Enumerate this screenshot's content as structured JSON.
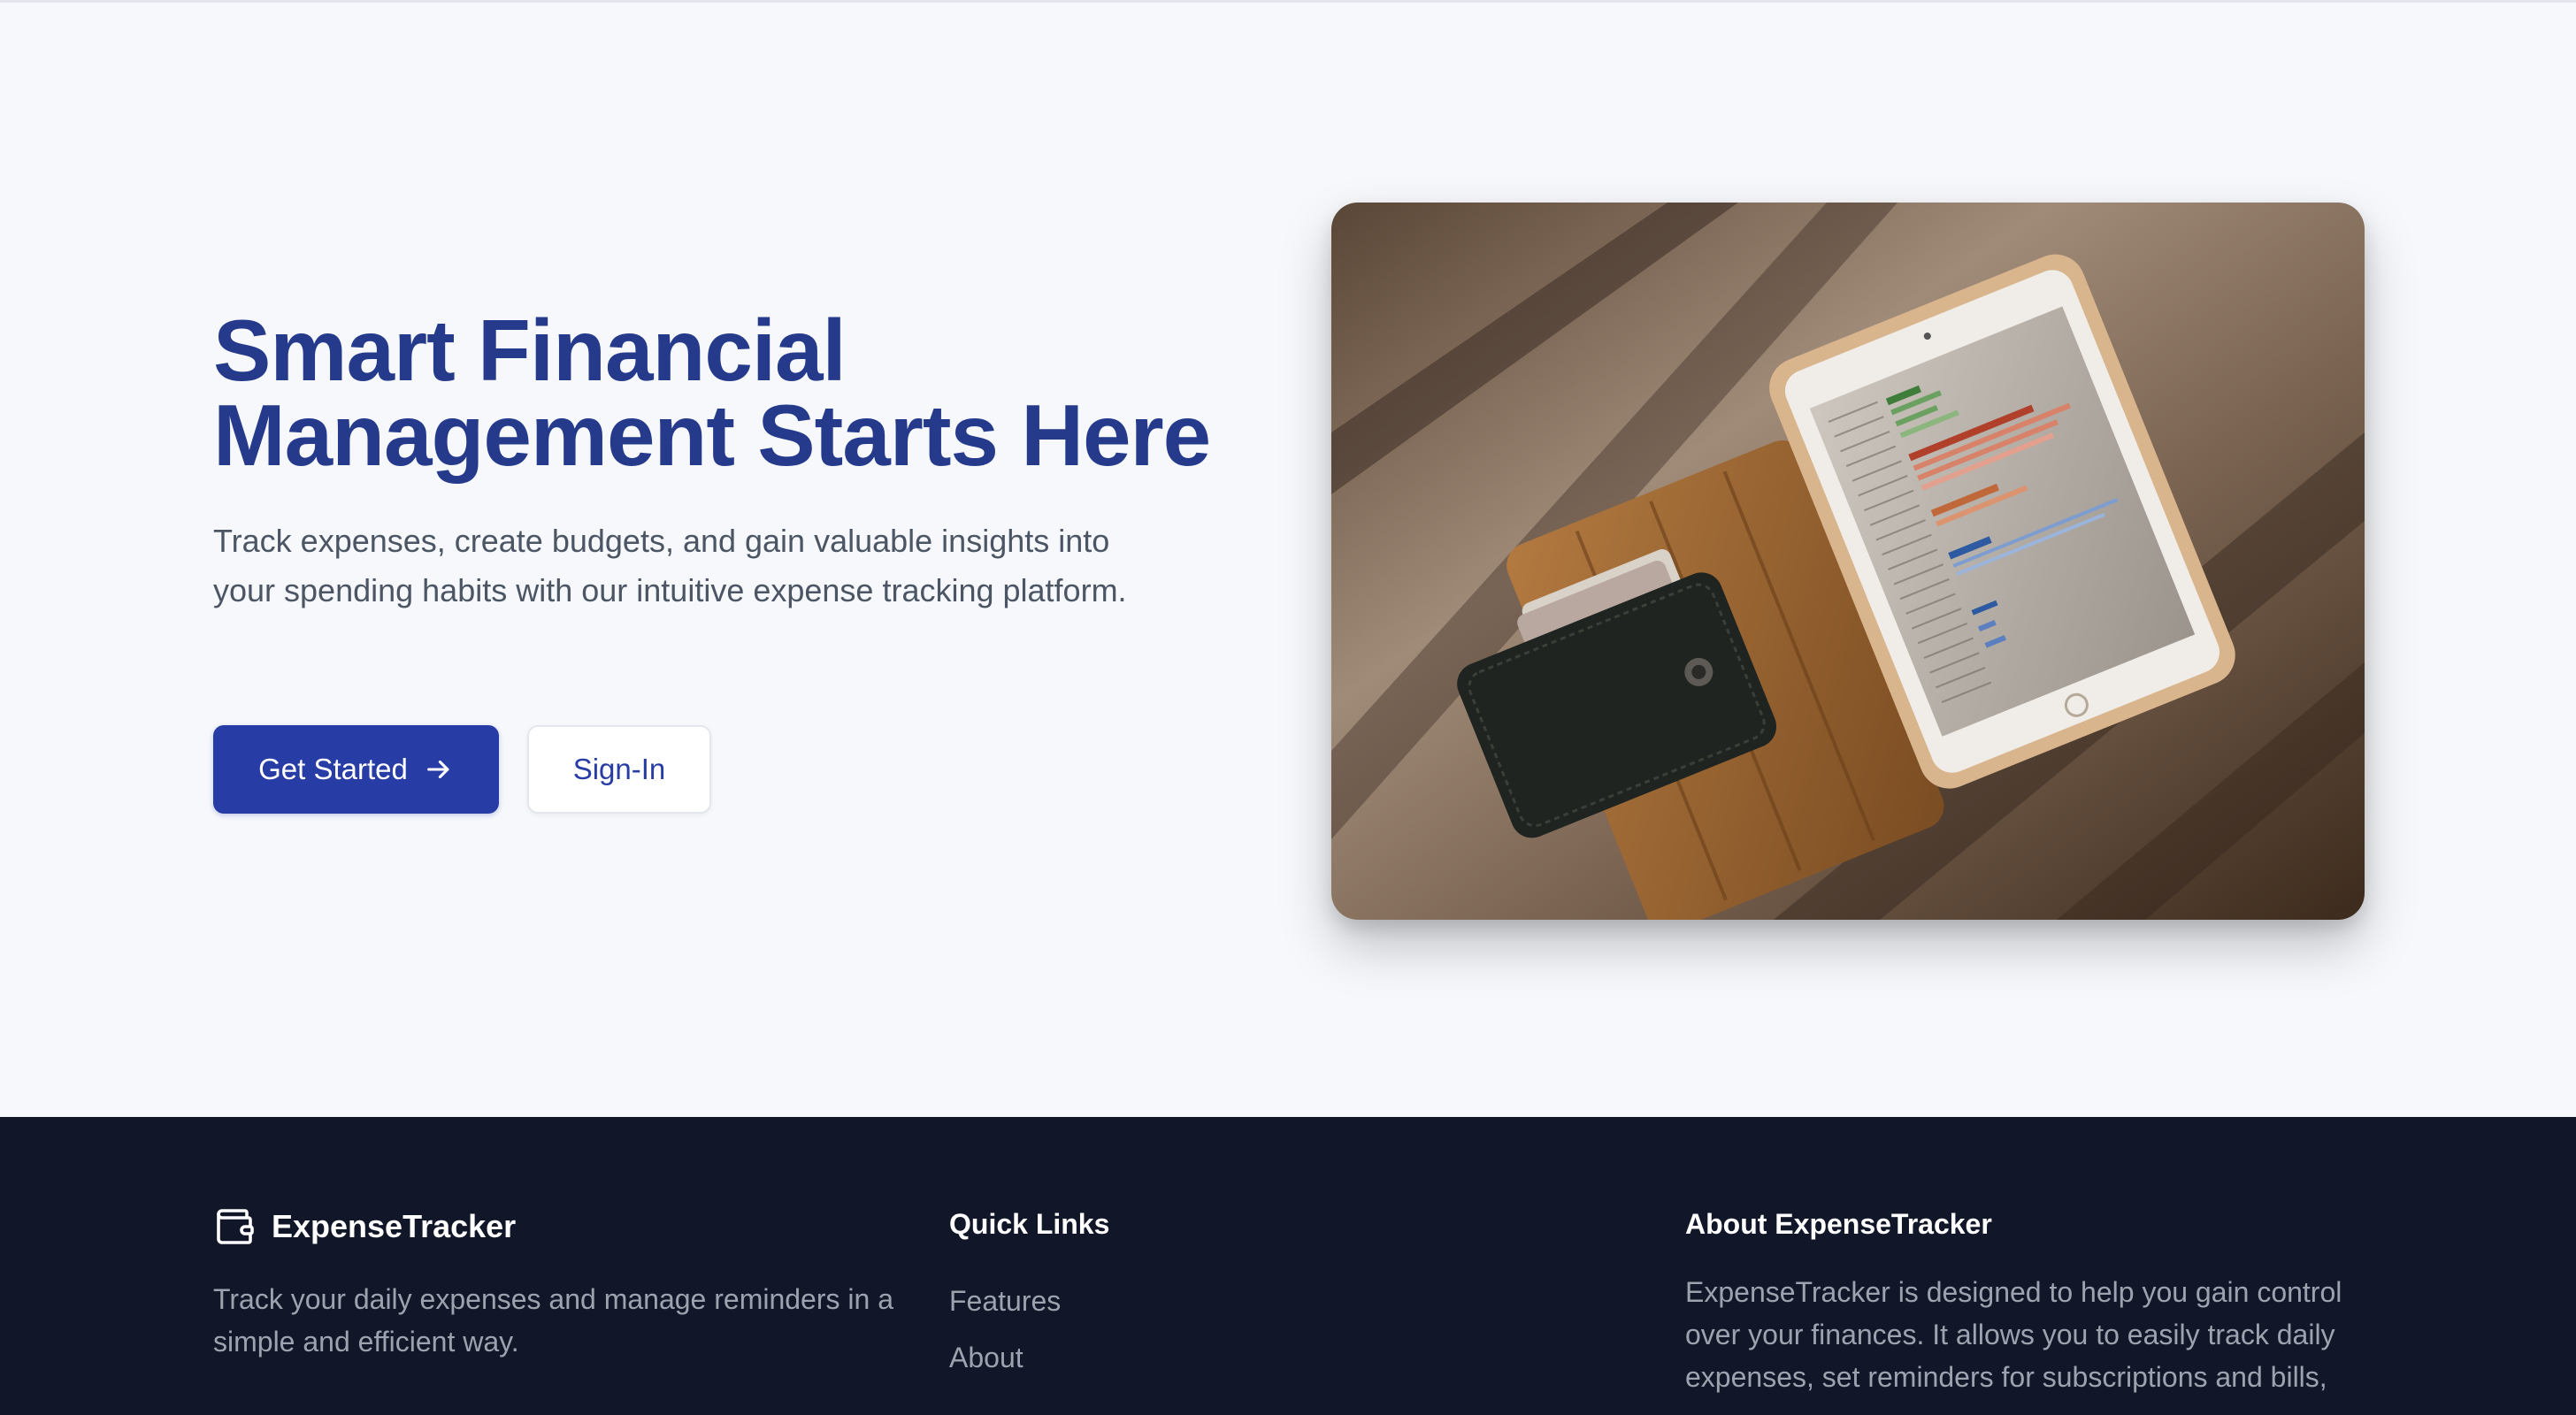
{
  "hero": {
    "title_line1": "Smart Financial",
    "title_line2": "Management Starts Here",
    "subtitle": "Track expenses, create budgets, and gain valuable insights into your spending habits with our intuitive expense tracking platform.",
    "primary_button": "Get Started",
    "secondary_button": "Sign-In",
    "image_subject": "wallet-and-tablet-photo"
  },
  "footer": {
    "brand_name": "ExpenseTracker",
    "brand_icon": "wallet-icon",
    "brand_desc": "Track your daily expenses and manage reminders in a simple and efficient way.",
    "quick_links_heading": "Quick Links",
    "quick_links": [
      {
        "label": "Features"
      },
      {
        "label": "About"
      }
    ],
    "about_heading": "About ExpenseTracker",
    "about_text": "ExpenseTracker is designed to help you gain control over your finances. It allows you to easily track daily expenses, set reminders for subscriptions and bills,"
  },
  "colors": {
    "accent": "#283ca6",
    "title": "#263a8c",
    "footer_bg": "#111729",
    "hero_bg": "#f6f8fc"
  }
}
